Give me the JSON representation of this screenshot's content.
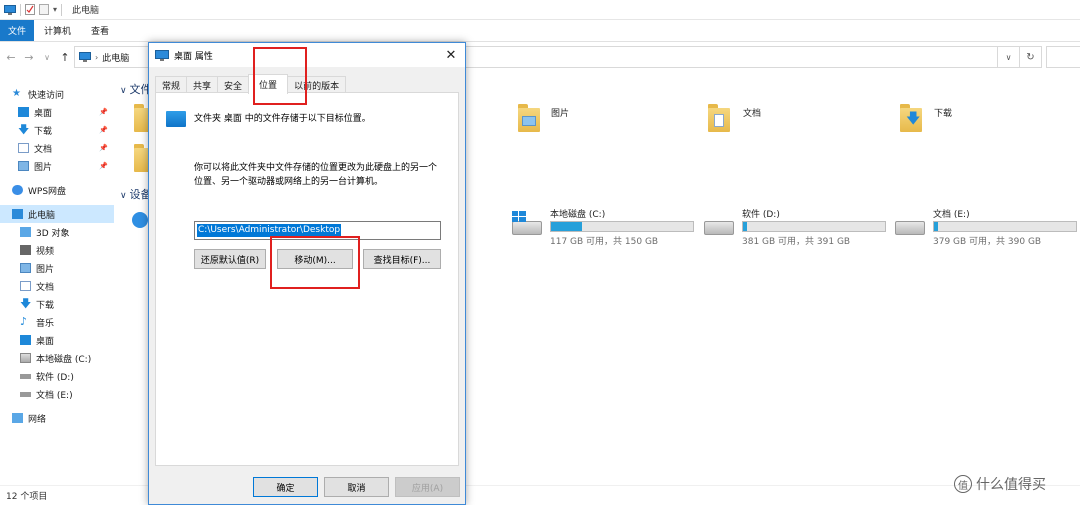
{
  "explorer": {
    "window_title": "此电脑",
    "ribbon_tabs": [
      "文件",
      "计算机",
      "查看"
    ],
    "address": "此电脑",
    "status": "12 个项目",
    "nav": {
      "quick_access": "快速访问",
      "pinned": [
        "桌面",
        "下载",
        "文档",
        "图片"
      ],
      "wps": "WPS网盘",
      "this_pc": "此电脑",
      "pc_items": [
        "3D 对象",
        "视频",
        "图片",
        "文档",
        "下载",
        "音乐",
        "桌面",
        "本地磁盘 (C:)",
        "软件 (D:)",
        "文档 (E:)"
      ],
      "network": "网络"
    },
    "sections": {
      "folders": "文件",
      "devices": "设备"
    },
    "folders": [
      "图片",
      "文档",
      "下载"
    ],
    "drives": [
      {
        "name": "本地磁盘 (C:)",
        "free": "117 GB 可用，共 150 GB",
        "used_fraction": 0.22
      },
      {
        "name": "软件 (D:)",
        "free": "381 GB 可用，共 391 GB",
        "used_fraction": 0.03
      },
      {
        "name": "文档 (E:)",
        "free": "379 GB 可用，共 390 GB",
        "used_fraction": 0.03
      }
    ]
  },
  "dialog": {
    "title": "桌面 属性",
    "tabs": [
      "常规",
      "共享",
      "安全",
      "位置",
      "以前的版本"
    ],
    "active_tab": "位置",
    "line1": "文件夹 桌面 中的文件存储于以下目标位置。",
    "desc1": "你可以将此文件夹中文件存储的位置更改为此硬盘上的另一个",
    "desc2": "位置、另一个驱动器或网络上的另一台计算机。",
    "path": "C:\\Users\\Administrator\\Desktop",
    "buttons": {
      "restore": "还原默认值(R)",
      "move": "移动(M)...",
      "find": "查找目标(F)...",
      "ok": "确定",
      "cancel": "取消",
      "apply": "应用(A)"
    }
  },
  "watermark": "什么值得买",
  "colors": {
    "accent": "#0078d7",
    "highlight": "#e0201f",
    "file_tab": "#1979ca"
  }
}
